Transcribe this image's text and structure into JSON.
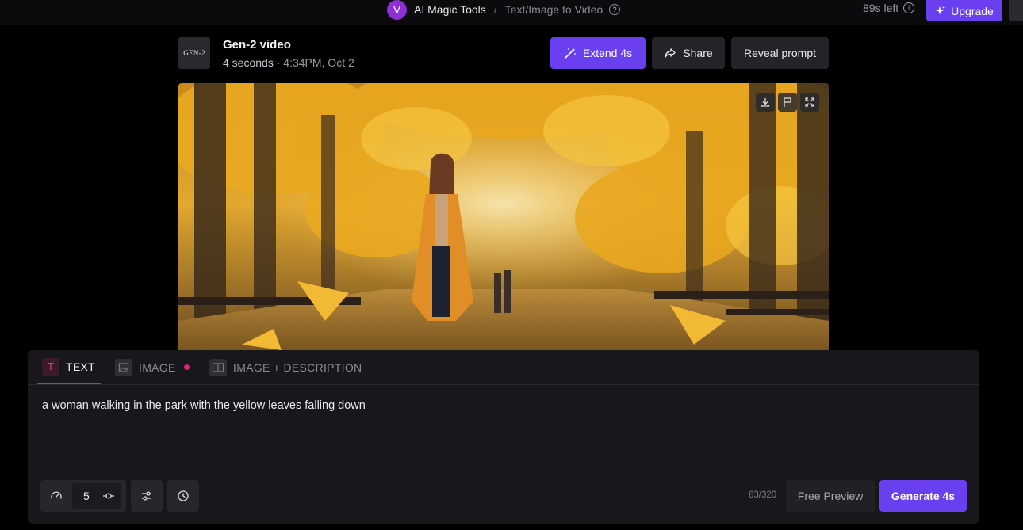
{
  "topbar": {
    "avatar_letter": "V",
    "tools_label": "AI Magic Tools",
    "separator": "/",
    "page_label": "Text/Image to Video",
    "seconds_left": "89s left",
    "upgrade_label": "Upgrade"
  },
  "video": {
    "thumb_label": "GEN-2",
    "title": "Gen-2 video",
    "duration": "4 seconds",
    "separator": " · ",
    "timestamp": "4:34PM, Oct 2",
    "extend_label": "Extend 4s",
    "share_label": "Share",
    "reveal_label": "Reveal prompt"
  },
  "tabs": {
    "text": "TEXT",
    "image": "IMAGE",
    "image_description": "IMAGE + DESCRIPTION"
  },
  "prompt": {
    "value": "a woman walking in the park with the yellow leaves falling down"
  },
  "controls": {
    "motion_value": "5",
    "char_count": "63/320",
    "free_preview_label": "Free Preview",
    "generate_label": "Generate 4s"
  },
  "colors": {
    "accent": "#6a3ff0",
    "tab_underline": "#c0306e",
    "dot": "#e0207a"
  }
}
